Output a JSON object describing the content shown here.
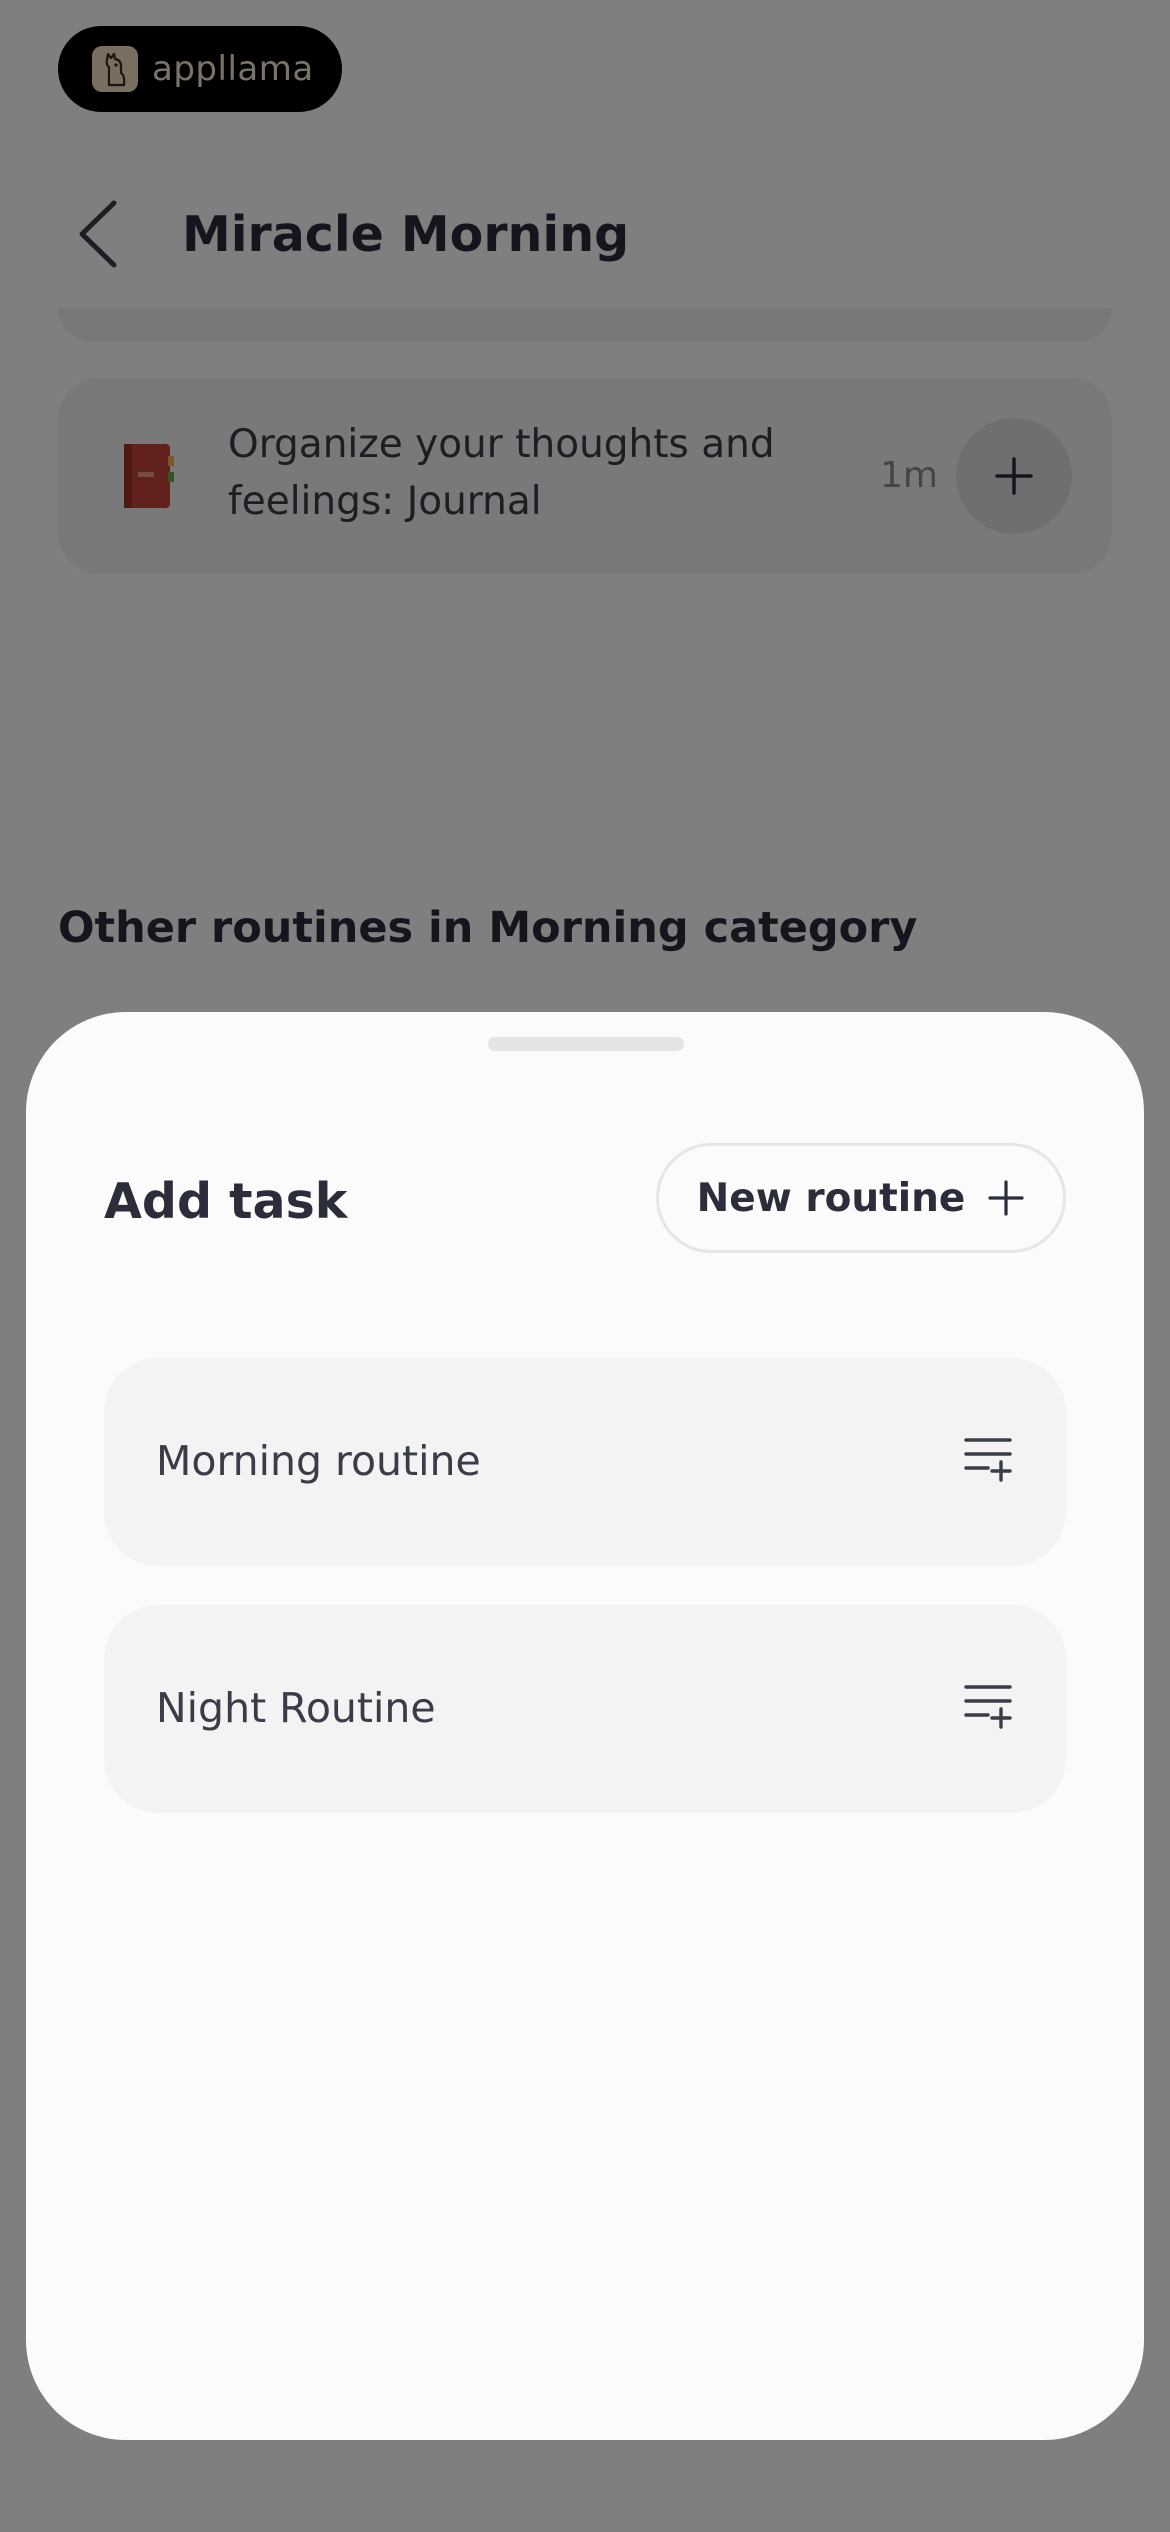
{
  "brand": {
    "name": "appllama",
    "logo_icon": "llama-icon"
  },
  "header": {
    "back_icon": "chevron-left-icon",
    "title": "Miracle Morning"
  },
  "task": {
    "text": "Organize your thoughts and feelings: Journal",
    "icon": "journal-icon",
    "duration": "1m",
    "add_icon": "plus-icon"
  },
  "section": {
    "heading": "Other routines in Morning category"
  },
  "sheet": {
    "title": "Add task",
    "new_routine_label": "New routine",
    "new_routine_icon": "plus-icon",
    "routines": [
      {
        "label": "Morning routine",
        "icon": "playlist-add-icon"
      },
      {
        "label": "Night Routine",
        "icon": "playlist-add-icon"
      }
    ]
  },
  "colors": {
    "overlay": "#000000",
    "sheet_background": "#fbfbfb",
    "card_background": "#f3f3f3",
    "text_primary": "#2b2d3a",
    "brand_text": "#f6e6d4"
  }
}
